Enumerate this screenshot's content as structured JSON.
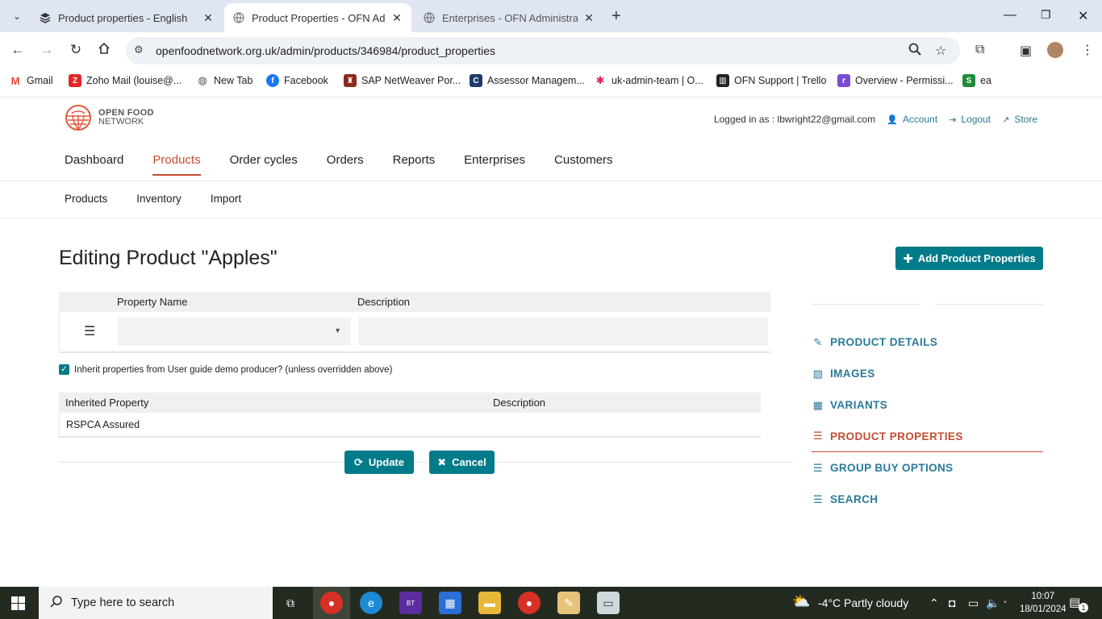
{
  "browser": {
    "tabs": [
      {
        "title": "Product properties - English",
        "active": false
      },
      {
        "title": "Product Properties - OFN Admin",
        "active": true
      },
      {
        "title": "Enterprises - OFN Administratio",
        "active": false
      }
    ],
    "url": "openfoodnetwork.org.uk/admin/products/346984/product_properties",
    "bookmarks": [
      {
        "label": "Gmail",
        "icon": "gmail-icon",
        "color": "#ea4335"
      },
      {
        "label": "Zoho Mail (louise@...",
        "icon": "zoho-icon",
        "color": "#e42527"
      },
      {
        "label": "New Tab",
        "icon": "globe-icon",
        "color": "#555555"
      },
      {
        "label": "Facebook",
        "icon": "facebook-icon",
        "color": "#1877f2"
      },
      {
        "label": "SAP NetWeaver Por...",
        "icon": "crest-icon",
        "color": "#8b2b1e"
      },
      {
        "label": "Assessor Managem...",
        "icon": "c-icon",
        "color": "#1f3a6e"
      },
      {
        "label": "uk-admin-team | O...",
        "icon": "slack-icon",
        "color": "#e01e5a"
      },
      {
        "label": "OFN Support | Trello",
        "icon": "trello-icon",
        "color": "#222222"
      },
      {
        "label": "Overview - Permissi...",
        "icon": "r-icon",
        "color": "#7b4bd0"
      },
      {
        "label": "ea",
        "icon": "s-icon",
        "color": "#1e8c3a"
      }
    ]
  },
  "header": {
    "logo_line1": "OPEN FOOD",
    "logo_line2": "NETWORK",
    "logged_in_as": "Logged in as : lbwright22@gmail.com",
    "account": "Account",
    "logout": "Logout",
    "store": "Store"
  },
  "mainnav": [
    "Dashboard",
    "Products",
    "Order cycles",
    "Orders",
    "Reports",
    "Enterprises",
    "Customers"
  ],
  "mainnav_active": "Products",
  "subnav": [
    "Products",
    "Inventory",
    "Import"
  ],
  "page": {
    "title": "Editing Product \"Apples\"",
    "add_button": "Add Product Properties",
    "col_property_name": "Property Name",
    "col_description": "Description",
    "inherit_label": "Inherit properties from User guide demo producer? (unless overridden above)",
    "inherit_checked": true,
    "col_inherited_property": "Inherited Property",
    "col_inherited_description": "Description",
    "inherited_rows": [
      {
        "property": "RSPCA Assured",
        "description": ""
      }
    ],
    "update_button": "Update",
    "cancel_button": "Cancel"
  },
  "sidemenu": [
    {
      "label": "PRODUCT DETAILS",
      "icon": "edit-icon",
      "active": false
    },
    {
      "label": "IMAGES",
      "icon": "image-icon",
      "active": false
    },
    {
      "label": "VARIANTS",
      "icon": "grid-icon",
      "active": false
    },
    {
      "label": "PRODUCT PROPERTIES",
      "icon": "list-icon",
      "active": true
    },
    {
      "label": "GROUP BUY OPTIONS",
      "icon": "list-icon",
      "active": false
    },
    {
      "label": "SEARCH",
      "icon": "list-icon",
      "active": false
    }
  ],
  "taskbar": {
    "search_placeholder": "Type here to search",
    "weather": "-4°C  Partly cloudy",
    "time": "10:07",
    "date": "18/01/2024",
    "notifications": "1"
  },
  "colors": {
    "teal": "#007b8a",
    "accent": "#c44d34",
    "link": "#2a7a99"
  }
}
